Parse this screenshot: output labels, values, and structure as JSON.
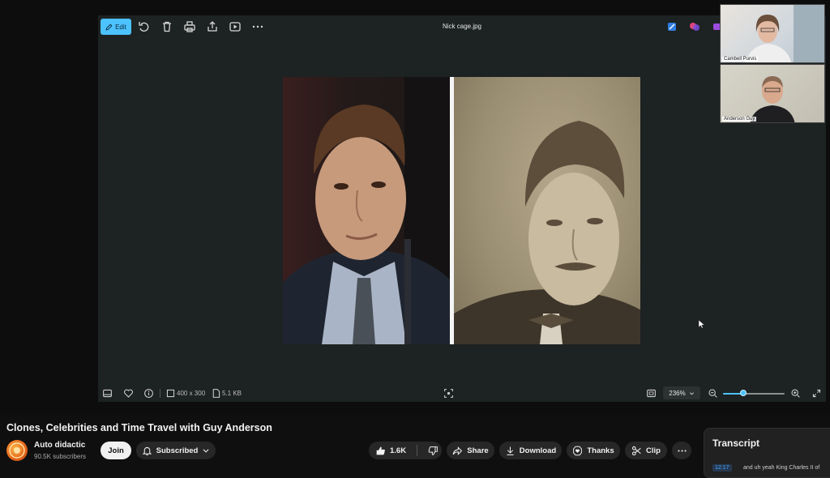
{
  "viewer": {
    "edit_label": "Edit",
    "filename": "Nick cage.jpg",
    "toolbar_icons": [
      "rotate-icon",
      "delete-icon",
      "print-icon",
      "share-icon",
      "slideshow-icon",
      "more-icon"
    ],
    "status": {
      "dimensions": "400 x 300",
      "file_size": "5.1 KB",
      "zoom": "236%",
      "zoom_level": 0.33
    }
  },
  "participants": [
    {
      "name": "Cambell Purvis"
    },
    {
      "name": "Anderson Guy"
    }
  ],
  "video": {
    "title": "Clones, Celebrities and Time Travel with Guy Anderson"
  },
  "channel": {
    "name": "Auto didactic",
    "subscribers": "90.5K subscribers",
    "join_label": "Join",
    "subscribed_label": "Subscribed"
  },
  "actions": {
    "likes": "1.6K",
    "share_label": "Share",
    "download_label": "Download",
    "thanks_label": "Thanks",
    "clip_label": "Clip"
  },
  "transcript": {
    "title": "Transcript",
    "first_time": "12:17",
    "first_text": "and uh yeah King Charles II of"
  },
  "colors": {
    "accent": "#4cc2ff",
    "background": "#0f0f0f",
    "viewer_background": "#1d2222"
  }
}
